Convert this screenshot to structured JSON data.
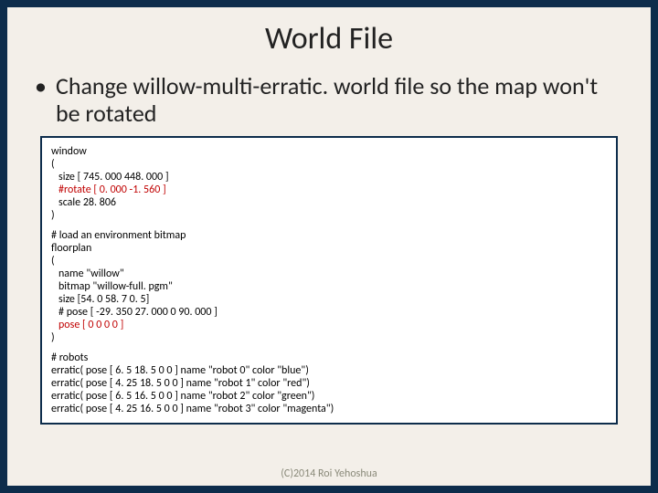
{
  "title": "World File",
  "bullet": "Change willow-multi-erratic. world file so the map won't be rotated",
  "code": {
    "win_open": "window",
    "brace_o": "(",
    "size": "size [ 745. 000 448. 000 ]",
    "rotate": "#rotate [ 0. 000 -1. 560 ]",
    "scale": "scale 28. 806",
    "brace_c": ")",
    "comment1": "# load an environment bitmap",
    "floorplan": "floorplan",
    "fp_o": "(",
    "fp_name": "name \"willow\"",
    "fp_bitmap": "bitmap \"willow-full. pgm\"",
    "fp_size": "size [54. 0 58. 7 0. 5]",
    "fp_pose_c": "# pose [ -29. 350 27. 000 0 90. 000 ]",
    "fp_pose": "pose [ 0 0 0 0 ]",
    "fp_c": ")",
    "robots_h": "# robots",
    "r0": "erratic( pose [ 6. 5 18. 5 0 0 ] name \"robot 0\" color \"blue\")",
    "r1": "erratic( pose [ 4. 25 18. 5 0 0 ] name \"robot 1\" color \"red\")",
    "r2": "erratic( pose [ 6. 5 16. 5 0 0 ] name \"robot 2\" color \"green\")",
    "r3": "erratic( pose [ 4. 25 16. 5 0 0 ] name \"robot 3\" color \"magenta\")"
  },
  "footer": "(C)2014 Roi Yehoshua"
}
